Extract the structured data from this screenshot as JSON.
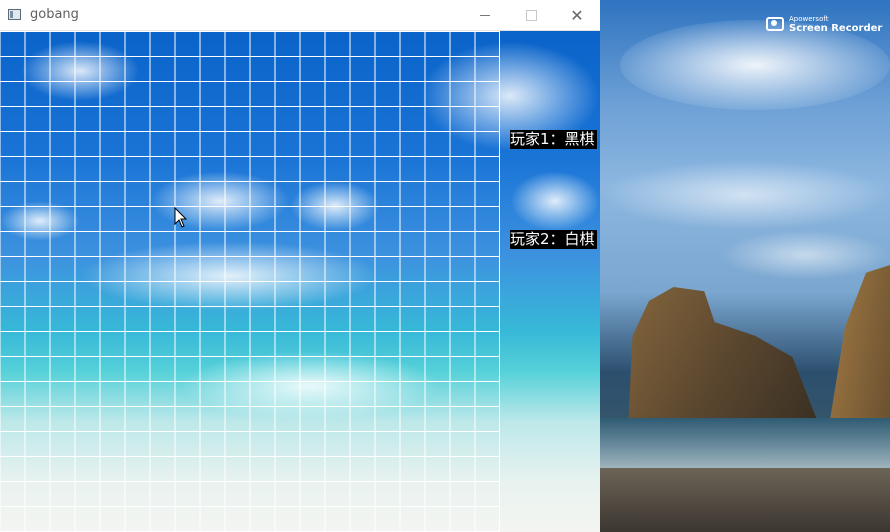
{
  "window": {
    "title": "gobang",
    "controls": [
      "minimize",
      "maximize",
      "close"
    ],
    "close_glyph": "✕"
  },
  "board": {
    "grid_lines": 20,
    "line_color": "#ffffff"
  },
  "players": {
    "player1": "玩家1：黑棋",
    "player2": "玩家2：白棋"
  },
  "desktop": {
    "recorder_brand": "Apowersoft",
    "recorder_name": "Screen Recorder"
  },
  "icons": {
    "app": "window-app-icon",
    "cursor": "mouse-pointer-icon",
    "recorder": "camera-icon"
  }
}
